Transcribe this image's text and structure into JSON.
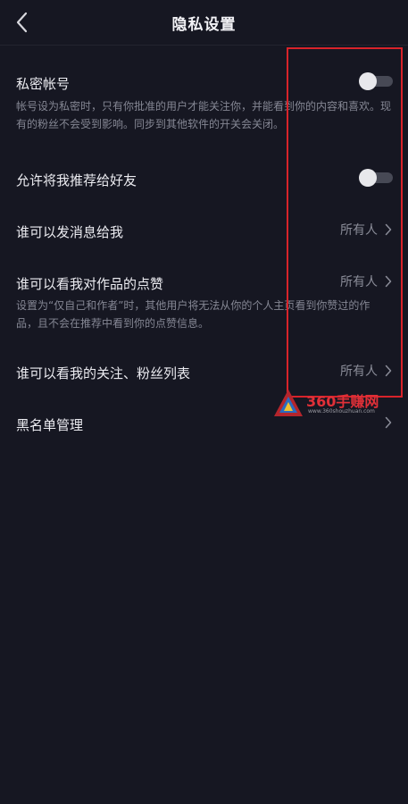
{
  "header": {
    "title": "隐私设置",
    "back_icon": "chevron-left-icon"
  },
  "settings": {
    "private_account": {
      "label": "私密帐号",
      "description": "帐号设为私密时，只有你批准的用户才能关注你，并能看到你的内容和喜欢。现有的粉丝不会受到影响。同步到其他软件的开关会关闭。",
      "enabled": false
    },
    "recommend_to_friends": {
      "label": "允许将我推荐给好友",
      "enabled": false
    },
    "who_can_message": {
      "label": "谁可以发消息给我",
      "value": "所有人"
    },
    "who_can_see_likes": {
      "label": "谁可以看我对作品的点赞",
      "value": "所有人",
      "description": "设置为“仅自己和作者”时，其他用户将无法从你的个人主页看到你赞过的作品，且不会在推荐中看到你的点赞信息。"
    },
    "who_can_see_follows": {
      "label": "谁可以看我的关注、粉丝列表",
      "value": "所有人"
    },
    "blacklist": {
      "label": "黑名单管理"
    }
  },
  "watermark": {
    "text": "360手赚网",
    "url": "www.360shouzhuan.com"
  },
  "colors": {
    "background": "#161722",
    "annotation": "#d8232a"
  }
}
